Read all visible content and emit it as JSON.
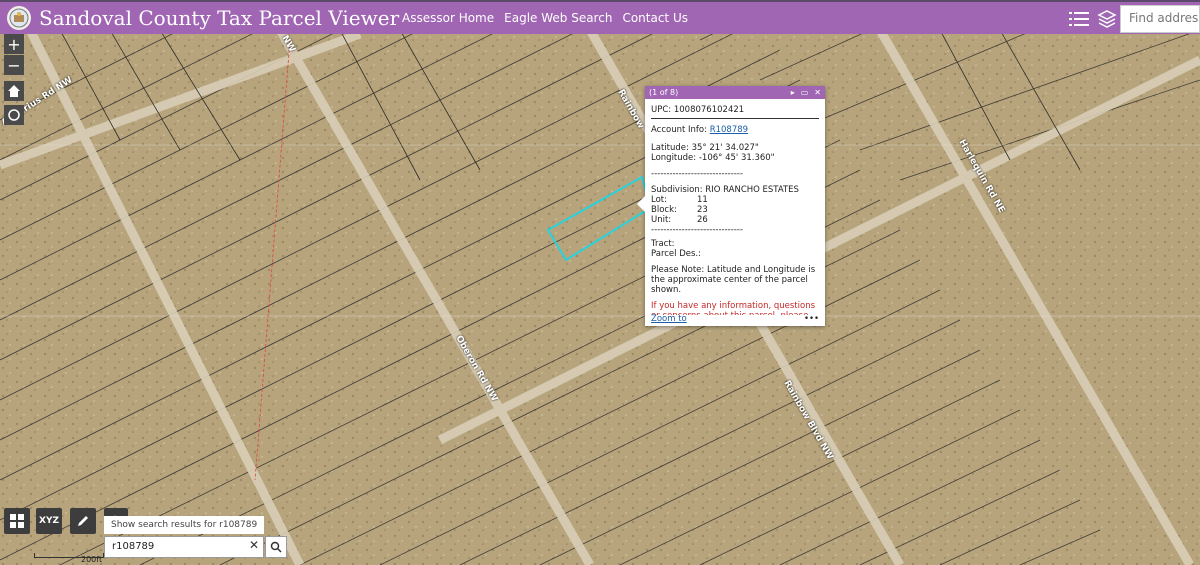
{
  "header": {
    "title": "Sandoval County Tax Parcel Viewer",
    "nav": [
      "Assessor Home",
      "Eagle Web Search",
      "Contact Us"
    ],
    "search_placeholder": "Find address or p"
  },
  "map": {
    "roads": [
      "Aquarius Rd NW",
      "Oberon Rd NW",
      "Rainbow Blvd NW",
      "Harlequin Rd NE",
      "Rainbow",
      "NW"
    ],
    "scale": "200ft"
  },
  "popup": {
    "counter": "(1 of 8)",
    "upc_label": "UPC:",
    "upc": "1008076102421",
    "account_label": "Account Info:",
    "account": "R108789",
    "latitude_label": "Latitude:",
    "latitude": "35° 21' 34.027\"",
    "longitude_label": "Longitude:",
    "longitude": "-106° 45' 31.360\"",
    "separator": "------------------------------",
    "subdivision_label": "Subdivision:",
    "subdivision": "RIO RANCHO ESTATES",
    "lot_label": "Lot:",
    "lot": "11",
    "block_label": "Block:",
    "block": "23",
    "unit_label": "Unit:",
    "unit": "26",
    "tract_label": "Tract:",
    "parcel_label": "Parcel Des.:",
    "note": "Please Note: Latitude and Longitude is the approximate center of the parcel shown.",
    "info_red": "If you have any information, questions or concerns about this parcel, please contact",
    "zoom_link": "Zoom to",
    "more": "•••"
  },
  "search": {
    "hint": "Show search results for r108789",
    "value": "r108789"
  },
  "tools": [
    "xyz"
  ]
}
